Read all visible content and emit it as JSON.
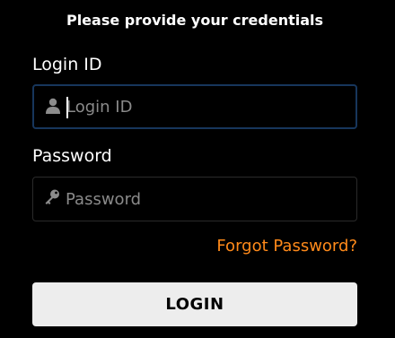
{
  "header": {
    "title": "Please provide your credentials"
  },
  "login_id": {
    "label": "Login ID",
    "placeholder": "Login ID",
    "value": "",
    "icon": "user-icon"
  },
  "password": {
    "label": "Password",
    "placeholder": "Password",
    "value": "",
    "icon": "key-icon"
  },
  "links": {
    "forgot_password": "Forgot Password?"
  },
  "actions": {
    "login_label": "LOGIN"
  },
  "colors": {
    "background": "#000000",
    "link": "#ff8a1a",
    "focus_border": "#17365c",
    "button_background": "#ededed"
  }
}
